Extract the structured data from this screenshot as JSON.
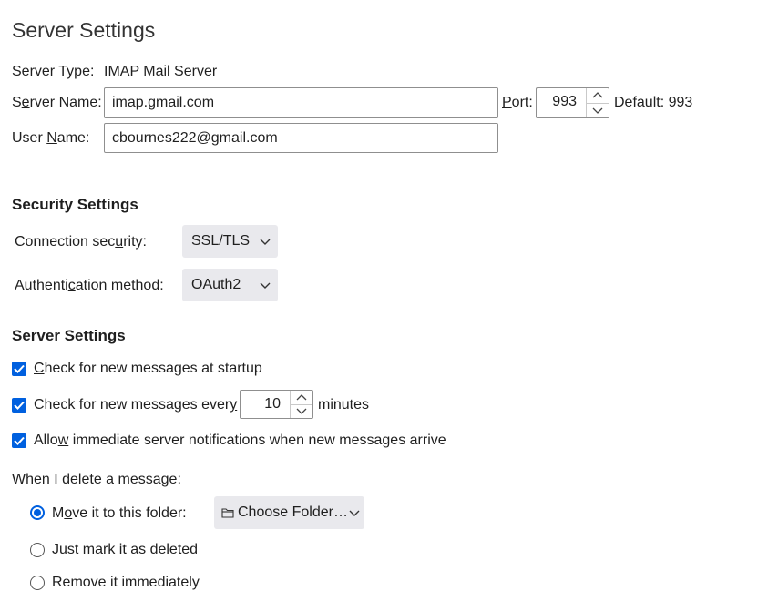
{
  "page": {
    "title": "Server Settings"
  },
  "server": {
    "type_label": "Server Type:",
    "type_value": "IMAP Mail Server",
    "name_label_pre": "S",
    "name_label_ul": "e",
    "name_label_post": "rver Name:",
    "name_value": "imap.gmail.com",
    "port_label_ul": "P",
    "port_label_post": "ort:",
    "port_value": "993",
    "default_label": "Default: 993",
    "user_label_pre": "User ",
    "user_label_ul": "N",
    "user_label_post": "ame:",
    "user_value": "cbournes222@gmail.com"
  },
  "security": {
    "heading": "Security Settings",
    "connection_label_pre": "Connection sec",
    "connection_label_ul": "u",
    "connection_label_post": "rity:",
    "connection_value": "SSL/TLS",
    "auth_label_pre": "Authenti",
    "auth_label_ul": "c",
    "auth_label_post": "ation method:",
    "auth_value": "OAuth2"
  },
  "server_settings": {
    "heading": "Server Settings",
    "check_startup_ul": "C",
    "check_startup_post": "heck for new messages at startup",
    "check_startup_checked": true,
    "check_every_pre": "Check for new messages ever",
    "check_every_ul": "y",
    "check_every_value": "10",
    "check_every_unit": "minutes",
    "check_every_checked": true,
    "allow_pre": "Allo",
    "allow_ul": "w",
    "allow_post": " immediate server notifications when new messages arrive",
    "allow_checked": true
  },
  "delete": {
    "heading": "When I delete a message:",
    "move_pre": "M",
    "move_ul": "o",
    "move_post": "ve it to this folder:",
    "move_selected": true,
    "folder_button": "Choose Folder…",
    "folder_icon": "folder-icon",
    "mark_pre": "Just mar",
    "mark_ul": "k",
    "mark_post": " it as deleted",
    "remove_label": "Remove it immediately"
  },
  "colors": {
    "accent": "#0060df",
    "dropdown_bg": "#e9e9ed"
  }
}
